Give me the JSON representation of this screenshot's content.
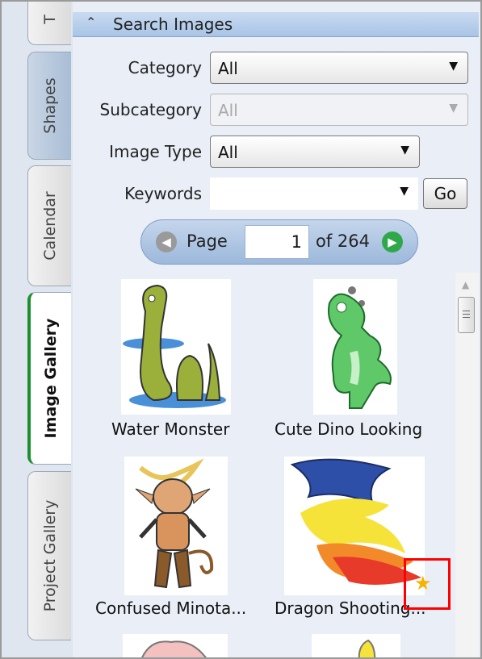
{
  "tabs": [
    {
      "label": "T",
      "state": "normal"
    },
    {
      "label": "Shapes",
      "state": "selected-blue"
    },
    {
      "label": "Calendar",
      "state": "normal"
    },
    {
      "label": "Image Gallery",
      "state": "active"
    },
    {
      "label": "Project Gallery",
      "state": "normal"
    }
  ],
  "panel": {
    "title": "Search Images",
    "collapse_icon": "chevron-up-icon"
  },
  "filters": {
    "category": {
      "label": "Category",
      "value": "All"
    },
    "subcategory": {
      "label": "Subcategory",
      "value": "All",
      "disabled": true
    },
    "image_type": {
      "label": "Image Type",
      "value": "All"
    },
    "keywords": {
      "label": "Keywords",
      "value": ""
    },
    "go_label": "Go"
  },
  "pager": {
    "page_label": "Page",
    "current": "1",
    "of_label": "of 264",
    "prev_icon": "arrow-left-icon",
    "next_icon": "arrow-right-icon"
  },
  "gallery": {
    "items": [
      {
        "caption": "Water Monster"
      },
      {
        "caption": "Cute Dino Looking"
      },
      {
        "caption": "Confused Minota..."
      },
      {
        "caption": "Dragon Shooting..."
      }
    ],
    "favorite_icon": "star-icon"
  },
  "colors": {
    "active_tab_accent": "#1e8f2e",
    "header_blue": "#a8c4e6",
    "highlight": "#ff0000",
    "star": "#f4b400"
  }
}
